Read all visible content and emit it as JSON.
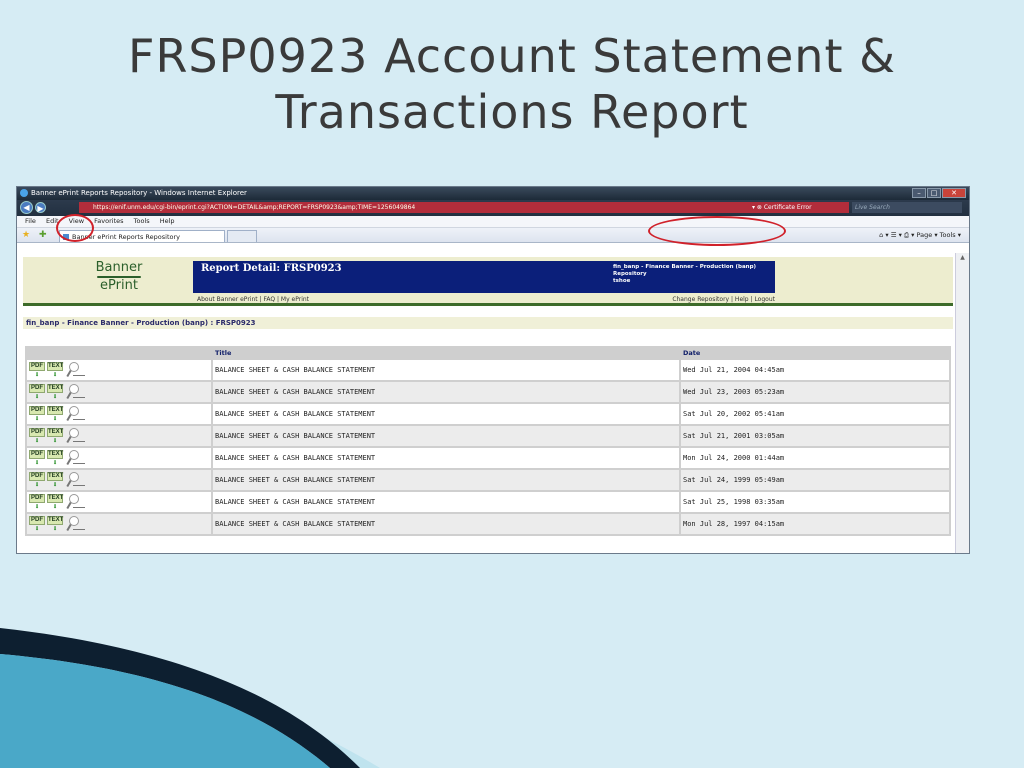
{
  "slide": {
    "title_line1": "FRSP0923 Account Statement &",
    "title_line2": "Transactions Report"
  },
  "browser": {
    "window_title": "Banner ePrint Reports Repository - Windows Internet Explorer",
    "address": "https://enif.unm.edu/cgi-bin/eprint.cgi?ACTION=DETAIL&amp;REPORT=FRSP0923&amp;TIME=1256049864",
    "certificate_error": "Certificate Error",
    "live_search_placeholder": "Live Search",
    "menu": [
      "File",
      "Edit",
      "View",
      "Favorites",
      "Tools",
      "Help"
    ],
    "tab_label": "Banner ePrint Reports Repository",
    "command_bar": "Page ▾ Tools ▾"
  },
  "eprint": {
    "logo_line1": "Banner",
    "logo_line2": "ePrint",
    "report_detail": "Report Detail: FRSP0923",
    "repo_info_line1": "fin_banp - Finance Banner - Production (banp)",
    "repo_info_line2": "Repository",
    "repo_info_line3": "tshoe",
    "links_left": "About Banner ePrint | FAQ | My ePrint",
    "links_right": "Change Repository | Help | Logout",
    "breadcrumb": "fin_banp - Finance Banner - Production (banp) : FRSP0923"
  },
  "table": {
    "columns": {
      "title": "Title",
      "date": "Date"
    },
    "format_labels": {
      "pdf": "PDF",
      "text": "TEXT"
    },
    "rows": [
      {
        "title": "BALANCE SHEET & CASH BALANCE STATEMENT",
        "date": "Wed Jul 21, 2004 04:45am"
      },
      {
        "title": "BALANCE SHEET & CASH BALANCE STATEMENT",
        "date": "Wed Jul 23, 2003 05:23am"
      },
      {
        "title": "BALANCE SHEET & CASH BALANCE STATEMENT",
        "date": "Sat Jul 20, 2002 05:41am"
      },
      {
        "title": "BALANCE SHEET & CASH BALANCE STATEMENT",
        "date": "Sat Jul 21, 2001 03:05am"
      },
      {
        "title": "BALANCE SHEET & CASH BALANCE STATEMENT",
        "date": "Mon Jul 24, 2000 01:44am"
      },
      {
        "title": "BALANCE SHEET & CASH BALANCE STATEMENT",
        "date": "Sat Jul 24, 1999 05:49am"
      },
      {
        "title": "BALANCE SHEET & CASH BALANCE STATEMENT",
        "date": "Sat Jul 25, 1998 03:35am"
      },
      {
        "title": "BALANCE SHEET & CASH BALANCE STATEMENT",
        "date": "Mon Jul 28, 1997 04:15am"
      }
    ]
  },
  "colors": {
    "slide_background": "#d6ecf4",
    "highlight_oval": "#d0212a",
    "header_bar": "#0b1f7a",
    "address_bar": "#b22d3b"
  }
}
